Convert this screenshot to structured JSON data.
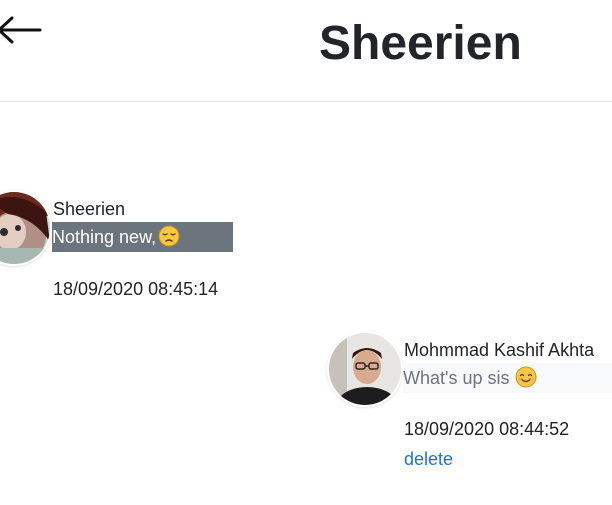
{
  "header": {
    "title": "Sheerien",
    "back_icon": "arrow-left-icon"
  },
  "messages": [
    {
      "sender": "Sheerien",
      "text": "Nothing new,",
      "emoji": "pensive-face-emoji",
      "timestamp": "18/09/2020 08:45:14",
      "bubble_color": "#6c757d"
    },
    {
      "sender": "Mohmmad Kashif Akhta",
      "text": "What's up sis",
      "emoji": "smiling-face-emoji",
      "timestamp": "18/09/2020 08:44:52",
      "delete_label": "delete",
      "bubble_color": "#f8f9fa"
    }
  ],
  "colors": {
    "link": "#1a73e8",
    "text": "#212529",
    "muted": "#6c757d"
  }
}
